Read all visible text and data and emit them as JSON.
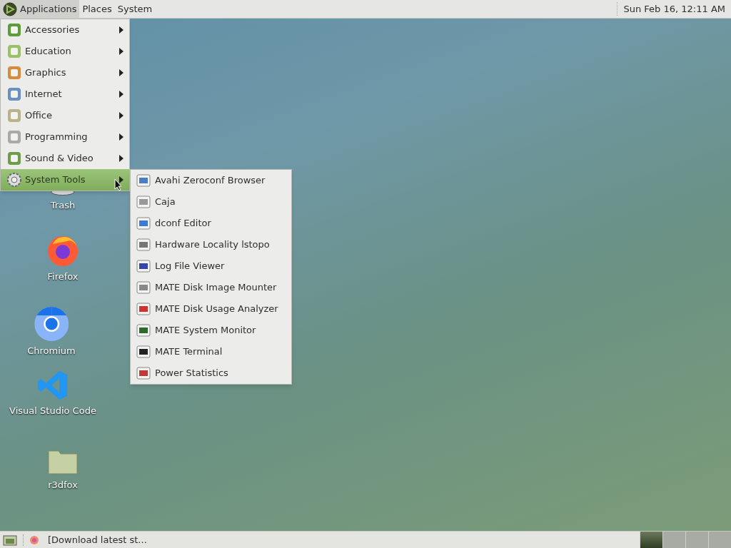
{
  "top_panel": {
    "menus": [
      {
        "label": "Applications",
        "selected": true
      },
      {
        "label": "Places",
        "selected": false
      },
      {
        "label": "System",
        "selected": false
      }
    ],
    "clock": "Sun Feb 16, 12:11 AM"
  },
  "app_menu": {
    "items": [
      {
        "label": "Accessories",
        "selected": false
      },
      {
        "label": "Education",
        "selected": false
      },
      {
        "label": "Graphics",
        "selected": false
      },
      {
        "label": "Internet",
        "selected": false
      },
      {
        "label": "Office",
        "selected": false
      },
      {
        "label": "Programming",
        "selected": false
      },
      {
        "label": "Sound & Video",
        "selected": false
      },
      {
        "label": "System Tools",
        "selected": true
      }
    ]
  },
  "submenu": {
    "items": [
      "Avahi Zeroconf Browser",
      "Caja",
      "dconf Editor",
      "Hardware Locality lstopo",
      "Log File Viewer",
      "MATE Disk Image Mounter",
      "MATE Disk Usage Analyzer",
      "MATE System Monitor",
      "MATE Terminal",
      "Power Statistics"
    ]
  },
  "desktop_icons": [
    {
      "label": "Trash",
      "kind": "trash"
    },
    {
      "label": "Firefox",
      "kind": "firefox"
    },
    {
      "label": "Chromium",
      "kind": "chromium"
    },
    {
      "label": "Visual Studio Code",
      "kind": "vscode"
    },
    {
      "label": "r3dfox",
      "kind": "folder"
    }
  ],
  "bottom_panel": {
    "tasks": [
      {
        "label": "[Download latest st..."
      }
    ],
    "workspaces": [
      {
        "selected": true
      },
      {
        "selected": false
      },
      {
        "selected": false
      },
      {
        "selected": false
      }
    ]
  }
}
